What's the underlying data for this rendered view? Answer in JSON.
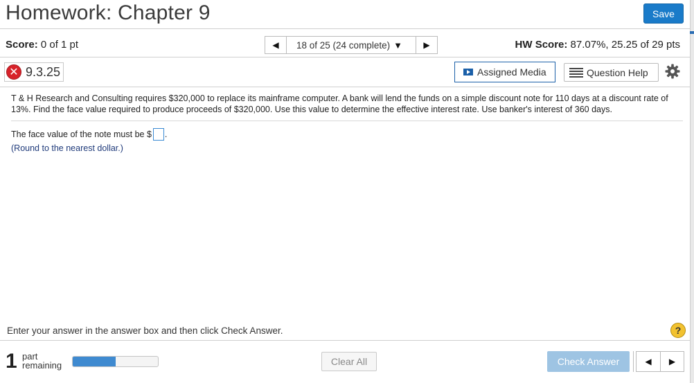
{
  "header": {
    "title": "Homework: Chapter 9",
    "save_label": "Save"
  },
  "score_bar": {
    "score_label": "Score:",
    "score_value": "0 of 1 pt",
    "nav_position": "18 of 25 (24 complete)",
    "hw_score_label": "HW Score:",
    "hw_score_value": "87.07%, 25.25 of 29 pts"
  },
  "question_bar": {
    "question_number": "9.3.25",
    "status": "incorrect",
    "assigned_media_label": "Assigned Media",
    "question_help_label": "Question Help"
  },
  "question": {
    "problem_text": "T & H Research and Consulting requires $320,000 to replace its mainframe computer. A bank will lend the funds on a simple discount note for 110 days at a discount rate of  13%. Find the face value required to produce proceeds of $320,000. Use this value to determine the effective interest rate. Use banker's interest of 360 days.",
    "answer_prefix": "The face value of the note must be $",
    "answer_value": "",
    "answer_suffix": ".",
    "round_note": "(Round to the nearest dollar.)"
  },
  "footer": {
    "instruction": "Enter your answer in the answer box and then click Check Answer.",
    "parts_remaining_count": "1",
    "parts_label_1": "part",
    "parts_label_2": "remaining",
    "progress_fraction": 0.5,
    "clear_all_label": "Clear All",
    "check_answer_label": "Check Answer"
  },
  "colors": {
    "accent": "#1a7bc9",
    "incorrect": "#d8222a",
    "help": "#f2c230",
    "progress": "#3f8ad0",
    "check_answer_disabled": "#9ec4e3"
  },
  "icons": [
    "incorrect-x-icon",
    "play-media-icon",
    "list-icon",
    "gear-icon",
    "help-question-icon",
    "arrow-left-icon",
    "arrow-right-icon",
    "caret-down-icon"
  ]
}
